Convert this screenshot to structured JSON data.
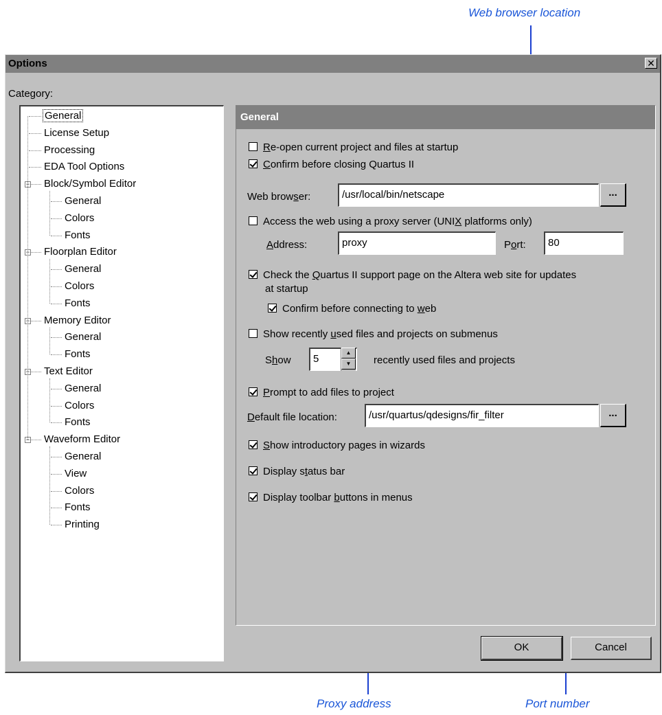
{
  "callouts": {
    "web_browser": "Web browser location",
    "proxy_address": "Proxy address",
    "port_number": "Port number"
  },
  "dialog": {
    "title": "Options",
    "close_glyph": "✕",
    "category_label": "Category:",
    "tree": {
      "items": [
        {
          "label": "General",
          "level": 1,
          "selected": true
        },
        {
          "label": "License Setup",
          "level": 1
        },
        {
          "label": "Processing",
          "level": 1
        },
        {
          "label": "EDA Tool Options",
          "level": 1
        },
        {
          "label": "Block/Symbol Editor",
          "level": 1,
          "expanded": true
        },
        {
          "label": "General",
          "level": 2
        },
        {
          "label": "Colors",
          "level": 2
        },
        {
          "label": "Fonts",
          "level": 2
        },
        {
          "label": "Floorplan Editor",
          "level": 1,
          "expanded": true
        },
        {
          "label": "General",
          "level": 2
        },
        {
          "label": "Colors",
          "level": 2
        },
        {
          "label": "Fonts",
          "level": 2
        },
        {
          "label": "Memory Editor",
          "level": 1,
          "expanded": true
        },
        {
          "label": "General",
          "level": 2
        },
        {
          "label": "Fonts",
          "level": 2
        },
        {
          "label": "Text Editor",
          "level": 1,
          "expanded": true
        },
        {
          "label": "General",
          "level": 2
        },
        {
          "label": "Colors",
          "level": 2
        },
        {
          "label": "Fonts",
          "level": 2
        },
        {
          "label": "Waveform Editor",
          "level": 1,
          "expanded": true
        },
        {
          "label": "General",
          "level": 2
        },
        {
          "label": "View",
          "level": 2
        },
        {
          "label": "Colors",
          "level": 2
        },
        {
          "label": "Fonts",
          "level": 2
        },
        {
          "label": "Printing",
          "level": 2
        }
      ]
    },
    "panel": {
      "header": "General",
      "reopen": {
        "pre": "",
        "u": "R",
        "post": "e-open current project and files at startup",
        "checked": false
      },
      "confirm_close": {
        "pre": "",
        "u": "C",
        "post": "onfirm before closing Quartus II",
        "checked": true
      },
      "web_browser": {
        "label_pre": "Web brow",
        "label_u": "s",
        "label_post": "er:",
        "value": "/usr/local/bin/netscape",
        "browse": "..."
      },
      "proxy": {
        "pre": "Access the web using a proxy server (UNI",
        "u": "X",
        "post": " platforms only)",
        "checked": false
      },
      "address": {
        "label_pre": "",
        "label_u": "A",
        "label_post": "ddress:",
        "value": "proxy"
      },
      "port": {
        "label_pre": "P",
        "label_u": "o",
        "label_post": "rt:",
        "value": "80"
      },
      "support_page": {
        "pre": "Check the ",
        "u": "Q",
        "post": "uartus II support page on the Altera web site for updates",
        "line2": "at startup",
        "checked": true
      },
      "confirm_web": {
        "pre": "Confirm before connecting to ",
        "u": "w",
        "post": "eb",
        "checked": true
      },
      "recent_files": {
        "pre": "Show recently ",
        "u": "u",
        "post": "sed files and projects on submenus",
        "checked": false
      },
      "show_count": {
        "label_pre": "S",
        "label_u": "h",
        "label_post": "ow",
        "value": "5",
        "suffix": "recently used files and projects",
        "up": "▲",
        "down": "▼"
      },
      "prompt_add": {
        "pre": "",
        "u": "P",
        "post": "rompt to add files to project",
        "checked": true
      },
      "default_loc": {
        "label_pre": "",
        "label_u": "D",
        "label_post": "efault file location:",
        "value": "/usr/quartus/qdesigns/fir_filter",
        "browse": "..."
      },
      "intro_pages": {
        "pre": "",
        "u": "S",
        "post": "how introductory pages in wizards",
        "checked": true
      },
      "status_bar": {
        "pre": "Display s",
        "u": "t",
        "post": "atus bar",
        "checked": true
      },
      "toolbar_buttons": {
        "pre": "Display toolbar ",
        "u": "b",
        "post": "uttons in menus",
        "checked": true
      }
    },
    "buttons": {
      "ok": "OK",
      "cancel": "Cancel"
    }
  }
}
